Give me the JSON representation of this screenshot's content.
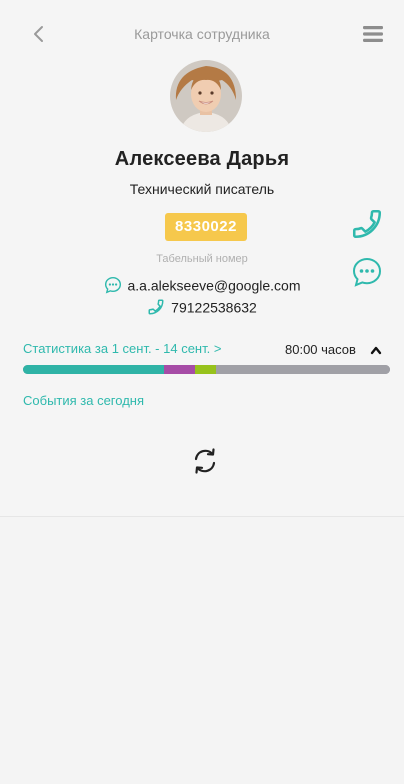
{
  "header": {
    "title": "Карточка сотрудника",
    "back_icon": "chevron-left-icon",
    "menu_icon": "hamburger-menu-icon"
  },
  "employee": {
    "name": "Алексеева  Дарья",
    "position": "Технический писатель",
    "tab_number": "8330022",
    "tab_number_label": "Табельный номер",
    "email": "a.a.alekseeve@google.com",
    "phone": "79122538632"
  },
  "stats": {
    "period_link": "Статистика за 1 сент. - 14 сент. >",
    "total_hours": "80:00 часов",
    "bar_segments": [
      {
        "fraction": 0.385,
        "color": "#2fb3a6"
      },
      {
        "fraction": 0.085,
        "color": "#a64ca6"
      },
      {
        "fraction": 0.055,
        "color": "#97c21c"
      },
      {
        "fraction": 0.475,
        "color": "#a0a0a6"
      }
    ]
  },
  "events": {
    "title": "События за сегодня"
  },
  "colors": {
    "accent": "#2fb9ad",
    "badge": "#f6c84c"
  }
}
